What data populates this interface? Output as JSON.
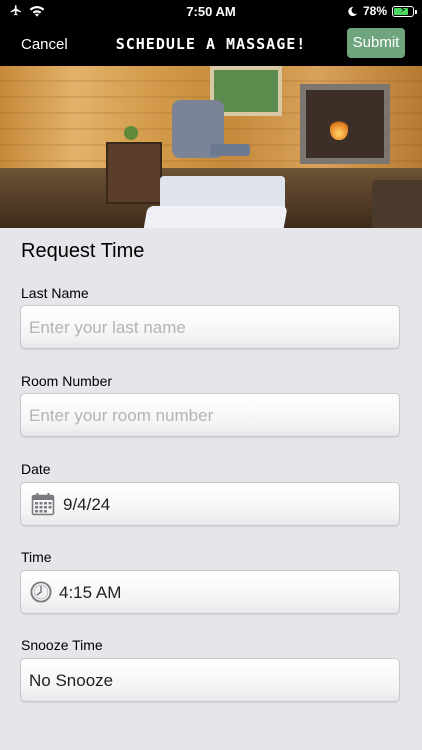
{
  "status": {
    "time": "7:50 AM",
    "battery_percent": "78%",
    "battery_level": 0.78
  },
  "nav": {
    "cancel_label": "Cancel",
    "title": "SCHEDULE A MASSAGE!",
    "submit_label": "Submit",
    "submit_color": "#6fa57d"
  },
  "hero": {
    "icon": "massage-room-photo"
  },
  "form": {
    "section_title": "Request Time",
    "last_name": {
      "label": "Last Name",
      "placeholder": "Enter your last name",
      "value": ""
    },
    "room_number": {
      "label": "Room Number",
      "placeholder": "Enter your room number",
      "value": ""
    },
    "date": {
      "label": "Date",
      "value": "9/4/24",
      "icon": "calendar-icon"
    },
    "time": {
      "label": "Time",
      "value": "4:15 AM",
      "icon": "clock-icon"
    },
    "snooze": {
      "label": "Snooze Time",
      "value": "No Snooze"
    }
  }
}
